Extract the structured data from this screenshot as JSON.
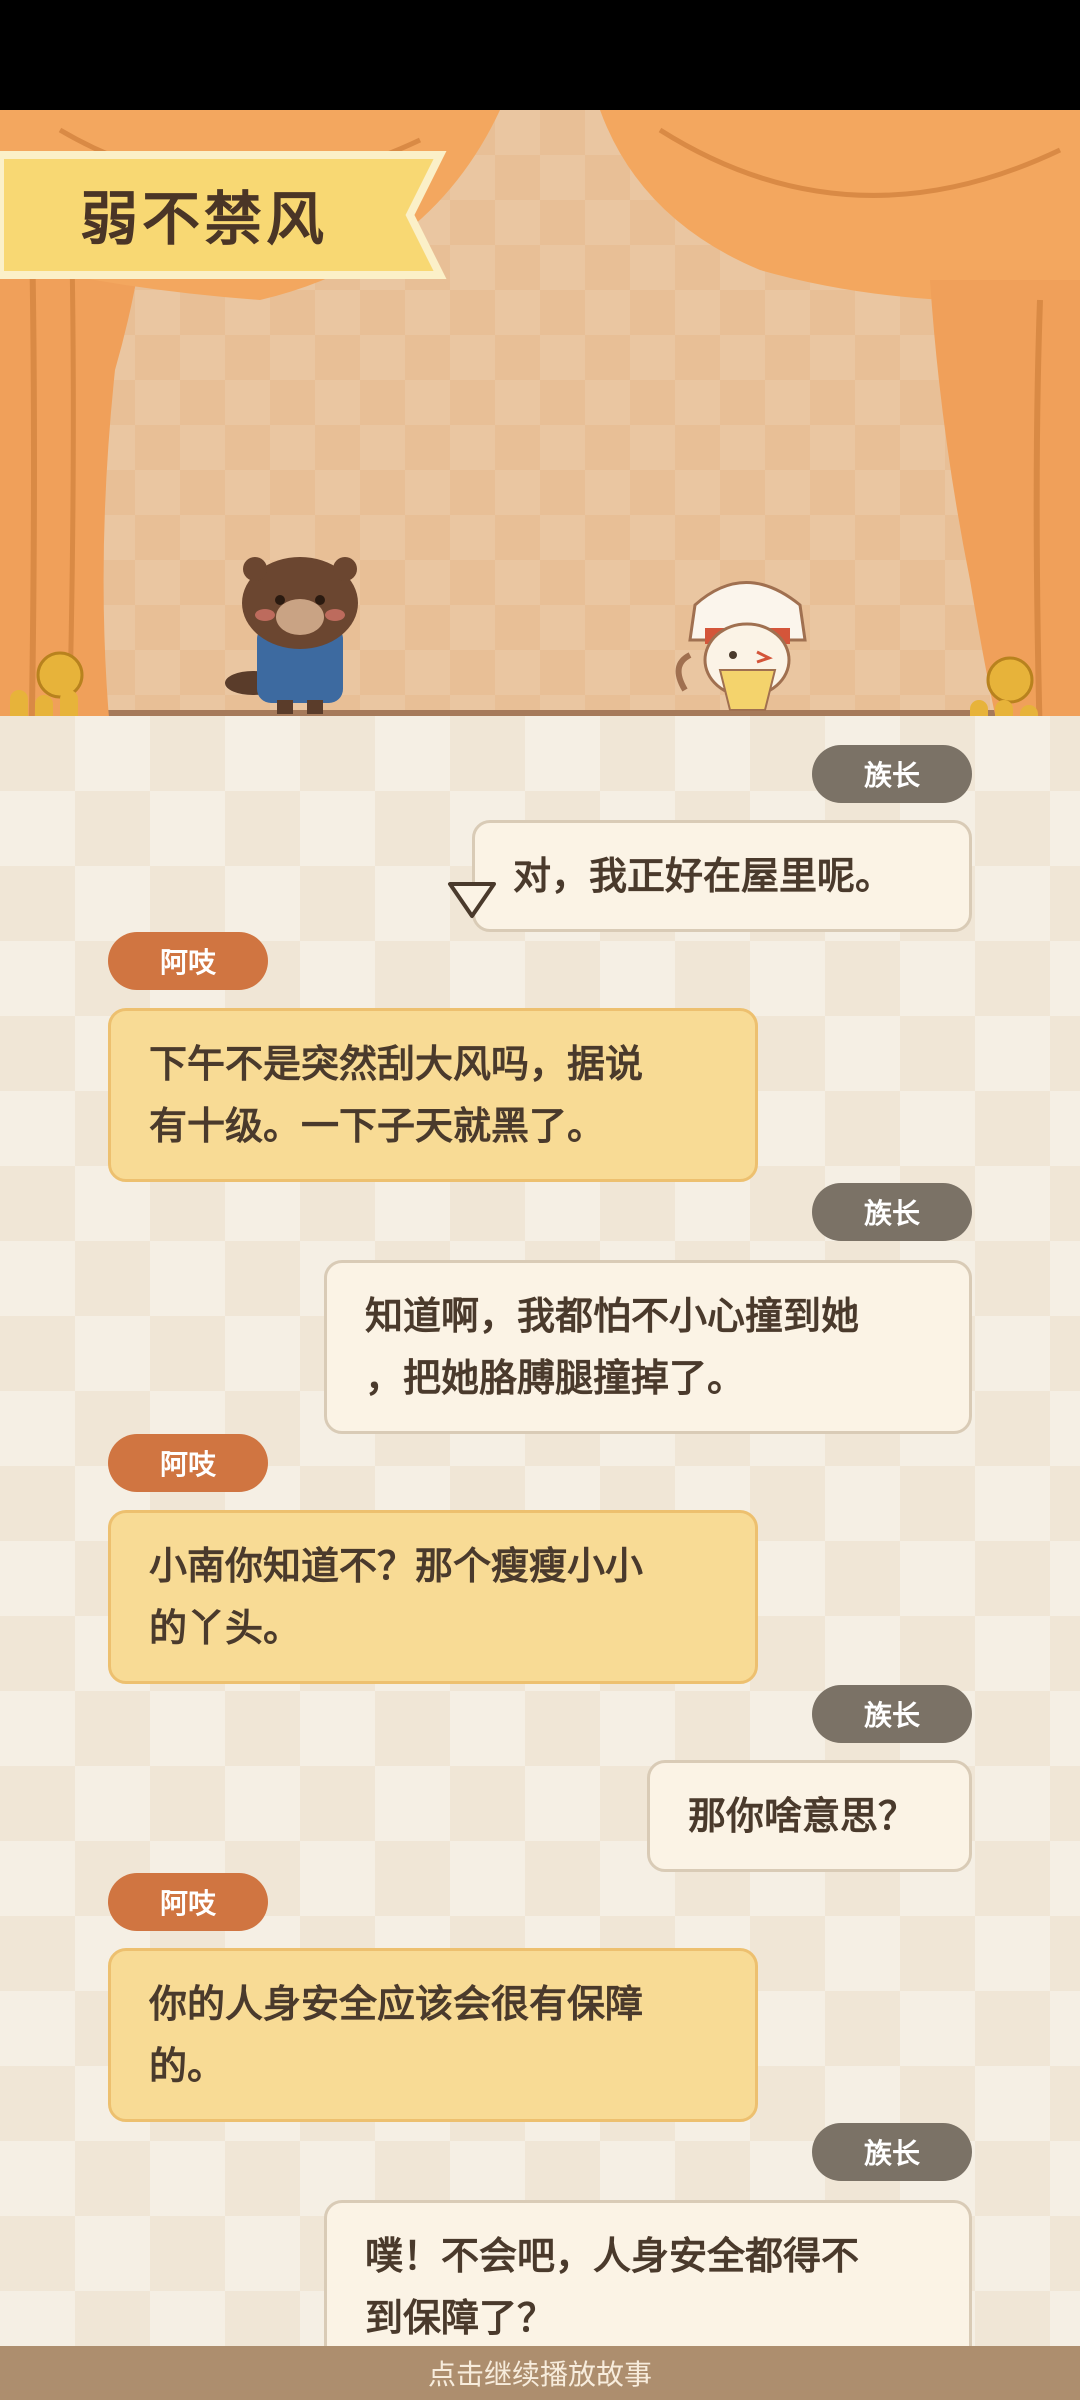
{
  "story_title": "弱不禁风",
  "characters": {
    "left": "beaver-character",
    "right": "chief-character"
  },
  "dialogue": [
    {
      "speaker": "族长",
      "side": "right",
      "text_lines": [
        "对，我正好在屋里呢。"
      ]
    },
    {
      "speaker": "阿吱",
      "side": "left",
      "text_lines": [
        "下午不是突然刮大风吗，据说",
        "有十级。一下子天就黑了。"
      ]
    },
    {
      "speaker": "族长",
      "side": "right",
      "text_lines": [
        "知道啊，我都怕不小心撞到她",
        "，把她胳膊腿撞掉了。"
      ]
    },
    {
      "speaker": "阿吱",
      "side": "left",
      "text_lines": [
        "小南你知道不？那个瘦瘦小小",
        "的丫头。"
      ]
    },
    {
      "speaker": "族长",
      "side": "right",
      "text_lines": [
        "那你啥意思？"
      ]
    },
    {
      "speaker": "阿吱",
      "side": "left",
      "text_lines": [
        "你的人身安全应该会很有保障",
        "的。"
      ]
    },
    {
      "speaker": "族长",
      "side": "right",
      "text_lines": [
        "噗！不会吧，人身安全都得不",
        "到保障了？"
      ]
    }
  ],
  "bottom_bar": {
    "label": "点击继续播放故事"
  },
  "colors": {
    "left_bubble": "#f8db95",
    "right_bubble": "#fbf3e5",
    "left_tag": "#d07541",
    "right_tag": "#7b7266",
    "curtain": "#f0a05a"
  }
}
